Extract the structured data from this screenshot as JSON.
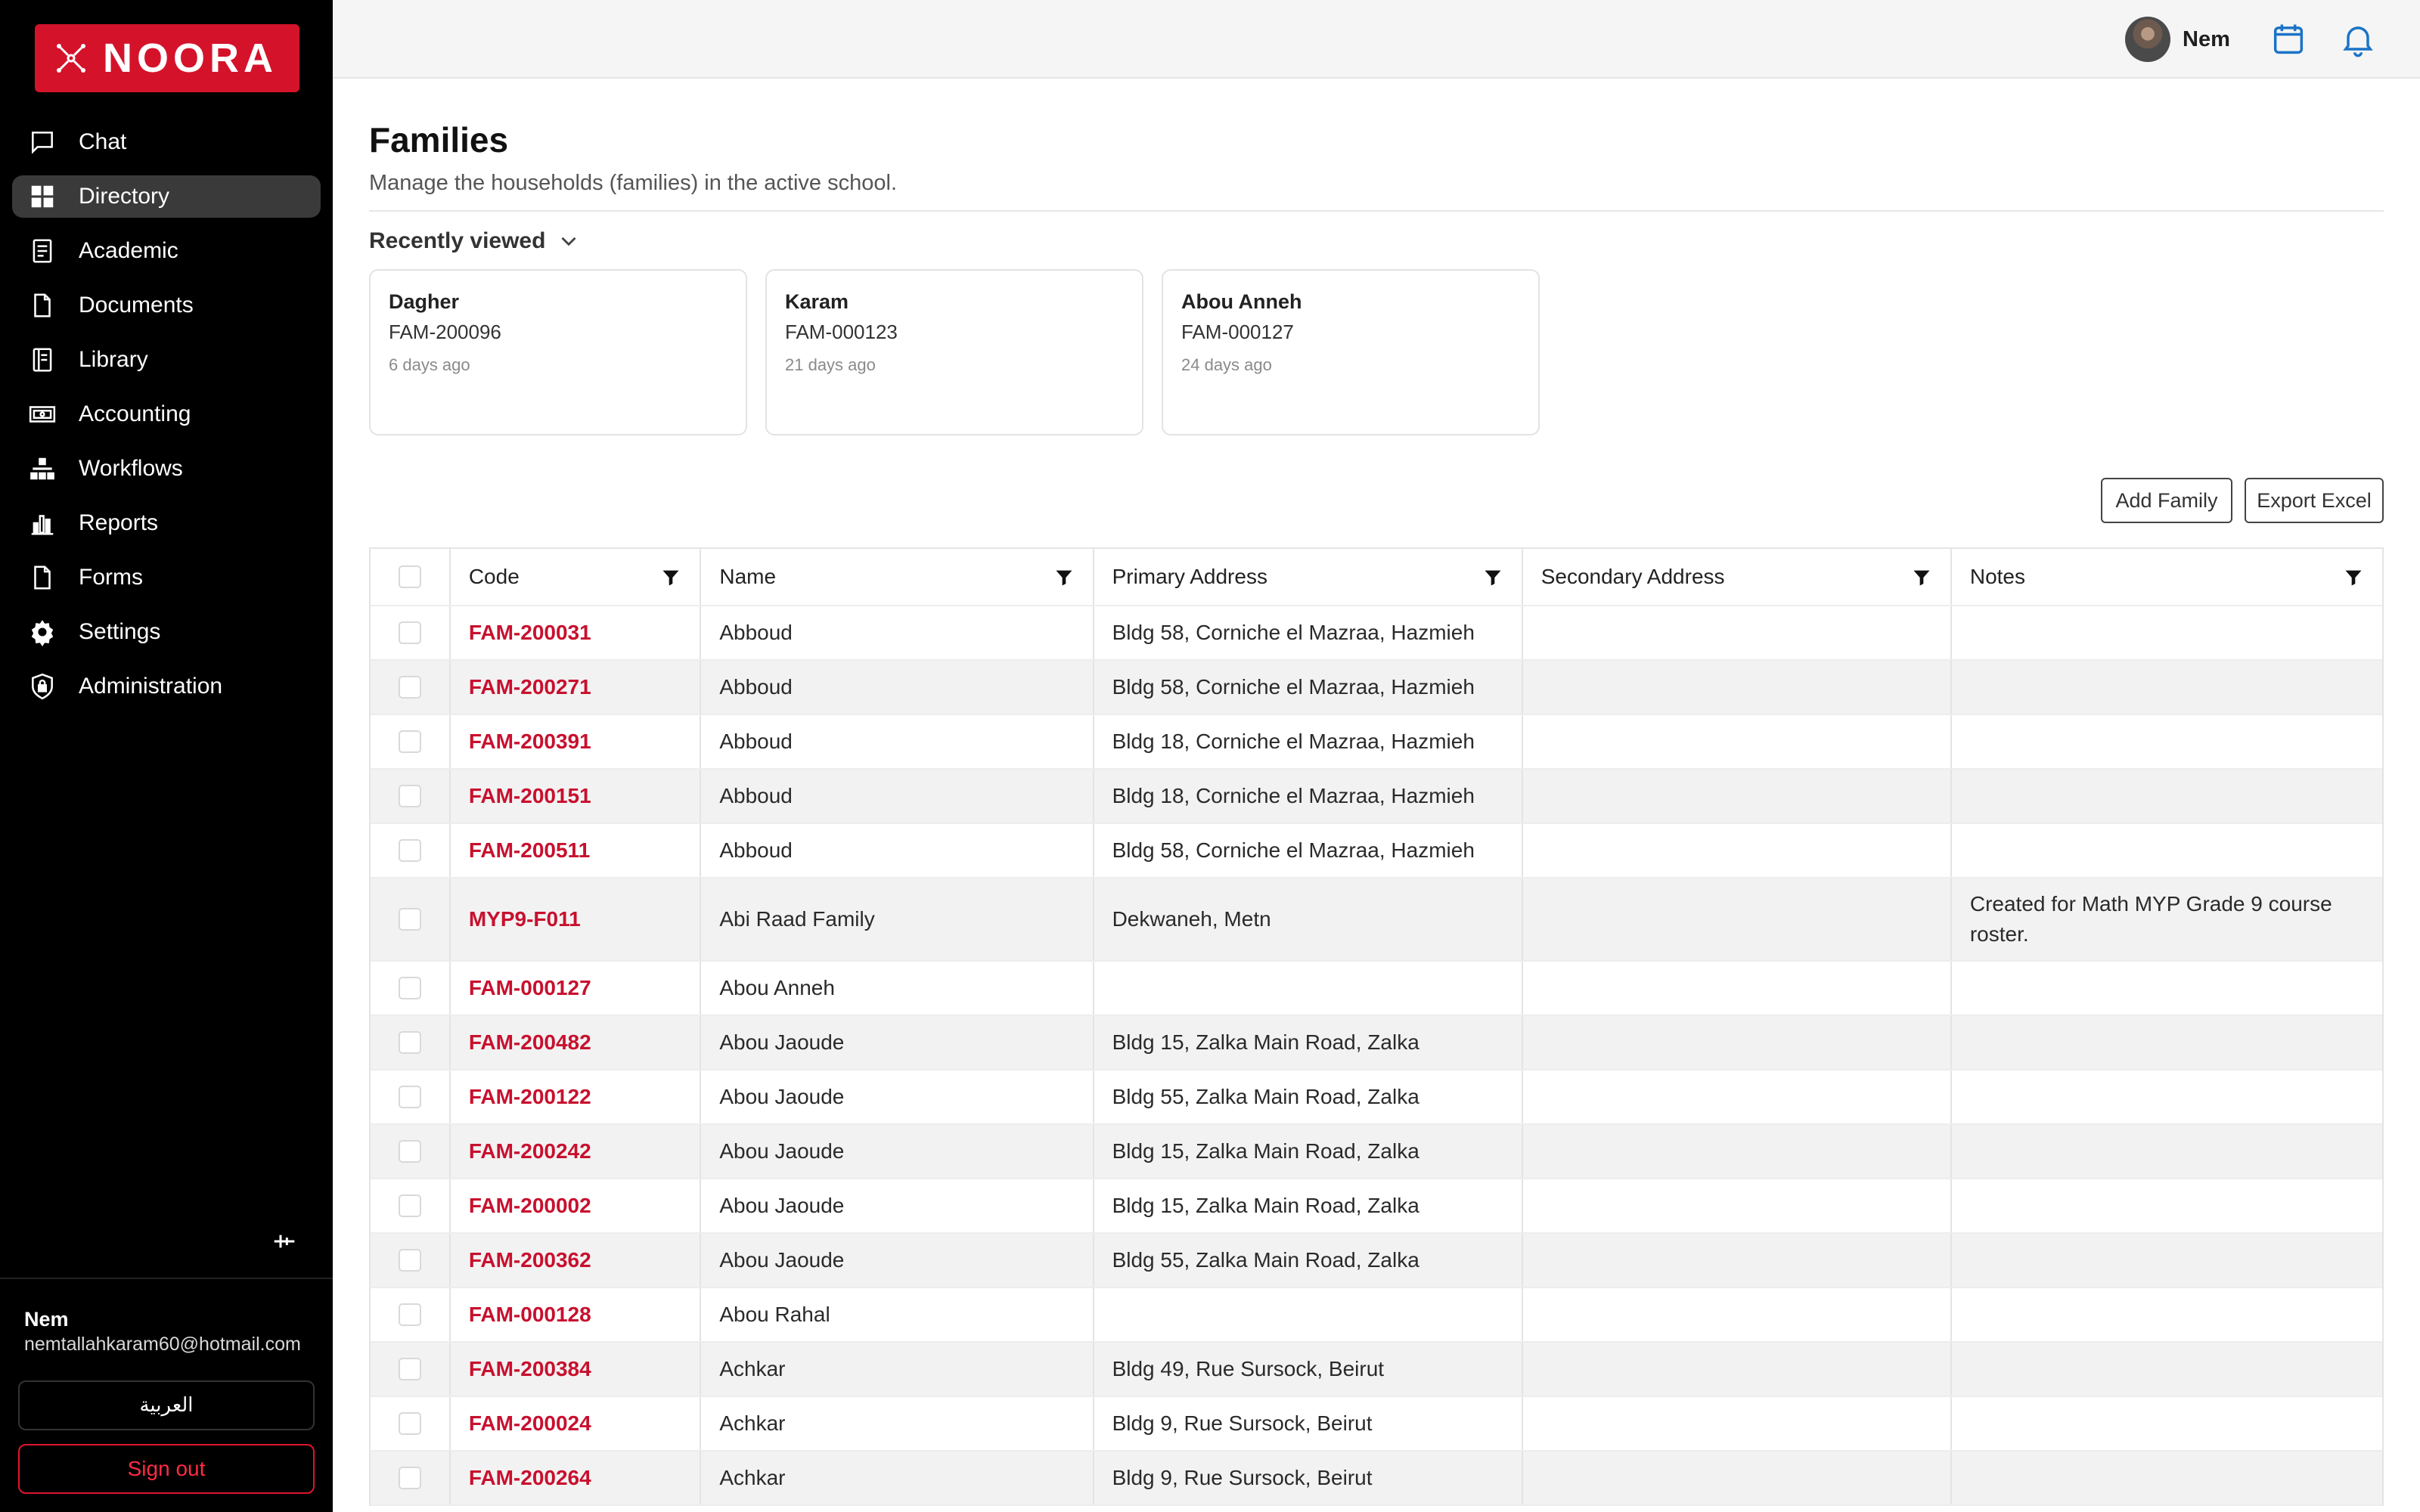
{
  "app": {
    "logo_text": "NOORA",
    "brand_color": "#d4132b",
    "link_color": "#c8102e"
  },
  "sidebar": {
    "items": [
      {
        "label": "Chat",
        "icon": "chat-icon"
      },
      {
        "label": "Directory",
        "icon": "grid-icon",
        "active": true
      },
      {
        "label": "Academic",
        "icon": "book-icon"
      },
      {
        "label": "Documents",
        "icon": "document-icon"
      },
      {
        "label": "Library",
        "icon": "library-icon"
      },
      {
        "label": "Accounting",
        "icon": "money-icon"
      },
      {
        "label": "Workflows",
        "icon": "workflow-icon"
      },
      {
        "label": "Reports",
        "icon": "chart-icon"
      },
      {
        "label": "Forms",
        "icon": "form-icon"
      },
      {
        "label": "Settings",
        "icon": "gear-icon"
      },
      {
        "label": "Administration",
        "icon": "shield-lock-icon"
      }
    ],
    "footer": {
      "user_name": "Nem",
      "user_email": "nemtallahkaram60@hotmail.com",
      "language_label": "العربية",
      "signout_label": "Sign out"
    }
  },
  "topbar": {
    "user_name": "Nem"
  },
  "main": {
    "title": "Families",
    "subtitle": "Manage the households (families) in the active school.",
    "recently_viewed": {
      "label": "Recently viewed",
      "cards": [
        {
          "name": "Dagher",
          "code": "FAM-200096",
          "time": "6 days ago"
        },
        {
          "name": "Karam",
          "code": "FAM-000123",
          "time": "21 days ago"
        },
        {
          "name": "Abou Anneh",
          "code": "FAM-000127",
          "time": "24 days ago"
        }
      ]
    },
    "actions": {
      "add_label": "Add Family",
      "export_label": "Export Excel"
    },
    "table": {
      "columns": {
        "code": "Code",
        "name": "Name",
        "primary": "Primary Address",
        "secondary": "Secondary Address",
        "notes": "Notes"
      },
      "rows": [
        {
          "code": "FAM-200031",
          "name": "Abboud",
          "primary": "Bldg 58, Corniche el Mazraa, Hazmieh",
          "secondary": "",
          "notes": ""
        },
        {
          "code": "FAM-200271",
          "name": "Abboud",
          "primary": "Bldg 58, Corniche el Mazraa, Hazmieh",
          "secondary": "",
          "notes": ""
        },
        {
          "code": "FAM-200391",
          "name": "Abboud",
          "primary": "Bldg 18, Corniche el Mazraa, Hazmieh",
          "secondary": "",
          "notes": ""
        },
        {
          "code": "FAM-200151",
          "name": "Abboud",
          "primary": "Bldg 18, Corniche el Mazraa, Hazmieh",
          "secondary": "",
          "notes": ""
        },
        {
          "code": "FAM-200511",
          "name": "Abboud",
          "primary": "Bldg 58, Corniche el Mazraa, Hazmieh",
          "secondary": "",
          "notes": ""
        },
        {
          "code": "MYP9-F011",
          "name": "Abi Raad Family",
          "primary": "Dekwaneh, Metn",
          "secondary": "",
          "notes": "Created for Math MYP Grade 9 course roster."
        },
        {
          "code": "FAM-000127",
          "name": "Abou Anneh",
          "primary": "",
          "secondary": "",
          "notes": ""
        },
        {
          "code": "FAM-200482",
          "name": "Abou Jaoude",
          "primary": "Bldg 15, Zalka Main Road, Zalka",
          "secondary": "",
          "notes": ""
        },
        {
          "code": "FAM-200122",
          "name": "Abou Jaoude",
          "primary": "Bldg 55, Zalka Main Road, Zalka",
          "secondary": "",
          "notes": ""
        },
        {
          "code": "FAM-200242",
          "name": "Abou Jaoude",
          "primary": "Bldg 15, Zalka Main Road, Zalka",
          "secondary": "",
          "notes": ""
        },
        {
          "code": "FAM-200002",
          "name": "Abou Jaoude",
          "primary": "Bldg 15, Zalka Main Road, Zalka",
          "secondary": "",
          "notes": ""
        },
        {
          "code": "FAM-200362",
          "name": "Abou Jaoude",
          "primary": "Bldg 55, Zalka Main Road, Zalka",
          "secondary": "",
          "notes": ""
        },
        {
          "code": "FAM-000128",
          "name": "Abou Rahal",
          "primary": "",
          "secondary": "",
          "notes": ""
        },
        {
          "code": "FAM-200384",
          "name": "Achkar",
          "primary": "Bldg 49, Rue Sursock, Beirut",
          "secondary": "",
          "notes": ""
        },
        {
          "code": "FAM-200024",
          "name": "Achkar",
          "primary": "Bldg 9, Rue Sursock, Beirut",
          "secondary": "",
          "notes": ""
        },
        {
          "code": "FAM-200264",
          "name": "Achkar",
          "primary": "Bldg 9, Rue Sursock, Beirut",
          "secondary": "",
          "notes": ""
        }
      ]
    }
  }
}
